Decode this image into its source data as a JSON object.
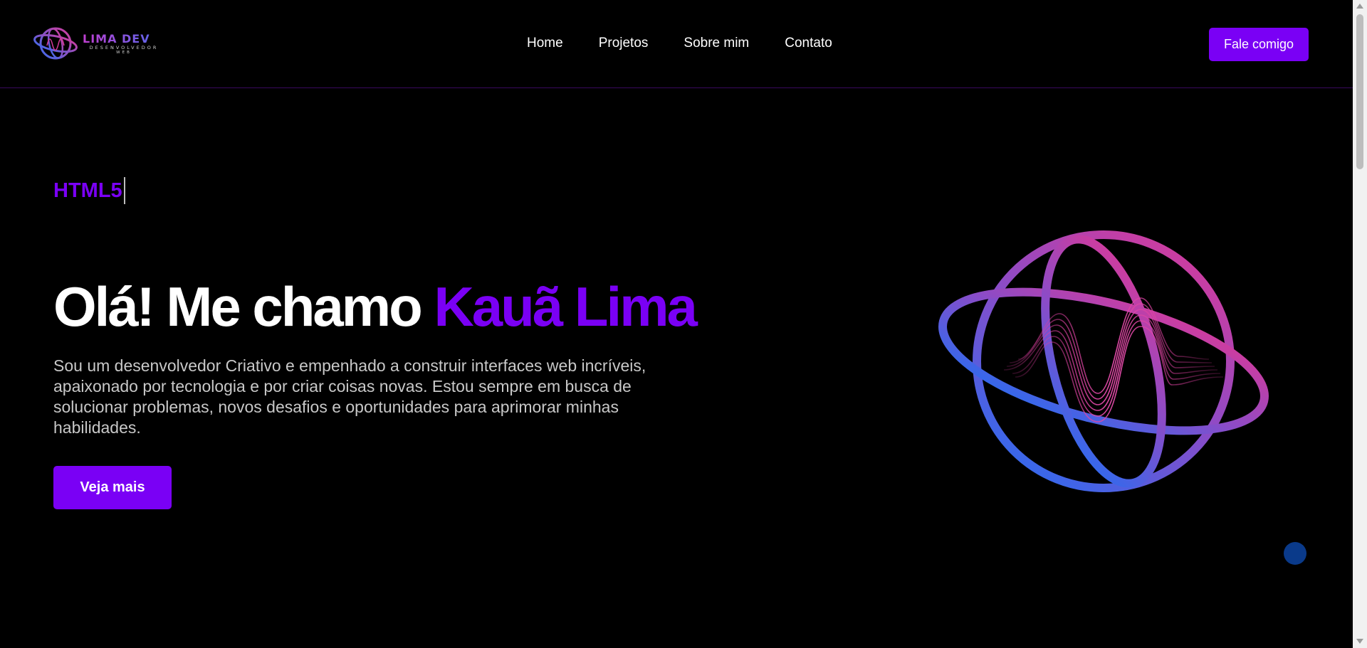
{
  "brand": {
    "name": "LIMA DEV",
    "tagline_line1": "DESENVOLVEDOR",
    "tagline_line2": "WEB"
  },
  "nav": {
    "items": [
      {
        "label": "Home"
      },
      {
        "label": "Projetos"
      },
      {
        "label": "Sobre mim"
      },
      {
        "label": "Contato"
      }
    ],
    "cta_label": "Fale comigo"
  },
  "hero": {
    "typed_text": "HTML5",
    "headline_prefix": "Olá! Me chamo ",
    "headline_name": "Kauã Lima",
    "description": "Sou um desenvolvedor Criativo e empenhado a construir interfaces web incríveis, apaixonado por tecnologia e por criar coisas novas. Estou sempre em busca de solucionar problemas, novos desafios e oportunidades para aprimorar minhas habilidades.",
    "button_label": "Veja mais"
  },
  "colors": {
    "accent": "#7a00f5",
    "background": "#000000",
    "globe_gradient_start": "#d63a9a",
    "globe_gradient_end": "#2a6cf0"
  },
  "icons": {
    "logo": "globe-wave-logo",
    "hero_art": "globe-wave-illustration",
    "floating": "circle-dot"
  }
}
